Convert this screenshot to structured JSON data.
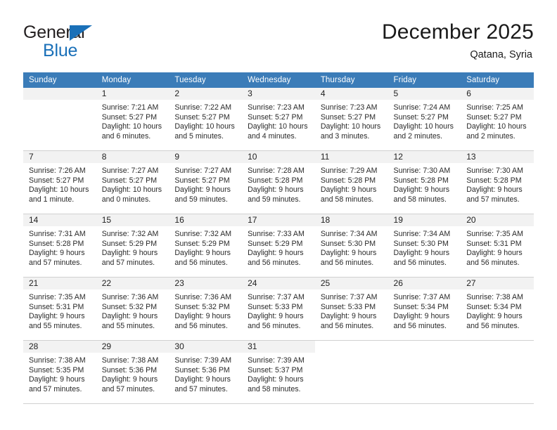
{
  "brand": {
    "name_part1": "General",
    "name_part2": "Blue",
    "triangle_icon": "triangle-icon",
    "color_primary": "#1a70b8",
    "color_text": "#231f20"
  },
  "header": {
    "title": "December 2025",
    "subtitle": "Qatana, Syria"
  },
  "calendar": {
    "header_background": "#3b7cb8",
    "daynum_background": "#f2f2f2",
    "weekday_headers": [
      "Sunday",
      "Monday",
      "Tuesday",
      "Wednesday",
      "Thursday",
      "Friday",
      "Saturday"
    ],
    "weeks": [
      [
        {
          "day": "",
          "lines": []
        },
        {
          "day": "1",
          "lines": [
            "Sunrise: 7:21 AM",
            "Sunset: 5:27 PM",
            "Daylight: 10 hours",
            "and 6 minutes."
          ]
        },
        {
          "day": "2",
          "lines": [
            "Sunrise: 7:22 AM",
            "Sunset: 5:27 PM",
            "Daylight: 10 hours",
            "and 5 minutes."
          ]
        },
        {
          "day": "3",
          "lines": [
            "Sunrise: 7:23 AM",
            "Sunset: 5:27 PM",
            "Daylight: 10 hours",
            "and 4 minutes."
          ]
        },
        {
          "day": "4",
          "lines": [
            "Sunrise: 7:23 AM",
            "Sunset: 5:27 PM",
            "Daylight: 10 hours",
            "and 3 minutes."
          ]
        },
        {
          "day": "5",
          "lines": [
            "Sunrise: 7:24 AM",
            "Sunset: 5:27 PM",
            "Daylight: 10 hours",
            "and 2 minutes."
          ]
        },
        {
          "day": "6",
          "lines": [
            "Sunrise: 7:25 AM",
            "Sunset: 5:27 PM",
            "Daylight: 10 hours",
            "and 2 minutes."
          ]
        }
      ],
      [
        {
          "day": "7",
          "lines": [
            "Sunrise: 7:26 AM",
            "Sunset: 5:27 PM",
            "Daylight: 10 hours",
            "and 1 minute."
          ]
        },
        {
          "day": "8",
          "lines": [
            "Sunrise: 7:27 AM",
            "Sunset: 5:27 PM",
            "Daylight: 10 hours",
            "and 0 minutes."
          ]
        },
        {
          "day": "9",
          "lines": [
            "Sunrise: 7:27 AM",
            "Sunset: 5:27 PM",
            "Daylight: 9 hours",
            "and 59 minutes."
          ]
        },
        {
          "day": "10",
          "lines": [
            "Sunrise: 7:28 AM",
            "Sunset: 5:28 PM",
            "Daylight: 9 hours",
            "and 59 minutes."
          ]
        },
        {
          "day": "11",
          "lines": [
            "Sunrise: 7:29 AM",
            "Sunset: 5:28 PM",
            "Daylight: 9 hours",
            "and 58 minutes."
          ]
        },
        {
          "day": "12",
          "lines": [
            "Sunrise: 7:30 AM",
            "Sunset: 5:28 PM",
            "Daylight: 9 hours",
            "and 58 minutes."
          ]
        },
        {
          "day": "13",
          "lines": [
            "Sunrise: 7:30 AM",
            "Sunset: 5:28 PM",
            "Daylight: 9 hours",
            "and 57 minutes."
          ]
        }
      ],
      [
        {
          "day": "14",
          "lines": [
            "Sunrise: 7:31 AM",
            "Sunset: 5:28 PM",
            "Daylight: 9 hours",
            "and 57 minutes."
          ]
        },
        {
          "day": "15",
          "lines": [
            "Sunrise: 7:32 AM",
            "Sunset: 5:29 PM",
            "Daylight: 9 hours",
            "and 57 minutes."
          ]
        },
        {
          "day": "16",
          "lines": [
            "Sunrise: 7:32 AM",
            "Sunset: 5:29 PM",
            "Daylight: 9 hours",
            "and 56 minutes."
          ]
        },
        {
          "day": "17",
          "lines": [
            "Sunrise: 7:33 AM",
            "Sunset: 5:29 PM",
            "Daylight: 9 hours",
            "and 56 minutes."
          ]
        },
        {
          "day": "18",
          "lines": [
            "Sunrise: 7:34 AM",
            "Sunset: 5:30 PM",
            "Daylight: 9 hours",
            "and 56 minutes."
          ]
        },
        {
          "day": "19",
          "lines": [
            "Sunrise: 7:34 AM",
            "Sunset: 5:30 PM",
            "Daylight: 9 hours",
            "and 56 minutes."
          ]
        },
        {
          "day": "20",
          "lines": [
            "Sunrise: 7:35 AM",
            "Sunset: 5:31 PM",
            "Daylight: 9 hours",
            "and 56 minutes."
          ]
        }
      ],
      [
        {
          "day": "21",
          "lines": [
            "Sunrise: 7:35 AM",
            "Sunset: 5:31 PM",
            "Daylight: 9 hours",
            "and 55 minutes."
          ]
        },
        {
          "day": "22",
          "lines": [
            "Sunrise: 7:36 AM",
            "Sunset: 5:32 PM",
            "Daylight: 9 hours",
            "and 55 minutes."
          ]
        },
        {
          "day": "23",
          "lines": [
            "Sunrise: 7:36 AM",
            "Sunset: 5:32 PM",
            "Daylight: 9 hours",
            "and 56 minutes."
          ]
        },
        {
          "day": "24",
          "lines": [
            "Sunrise: 7:37 AM",
            "Sunset: 5:33 PM",
            "Daylight: 9 hours",
            "and 56 minutes."
          ]
        },
        {
          "day": "25",
          "lines": [
            "Sunrise: 7:37 AM",
            "Sunset: 5:33 PM",
            "Daylight: 9 hours",
            "and 56 minutes."
          ]
        },
        {
          "day": "26",
          "lines": [
            "Sunrise: 7:37 AM",
            "Sunset: 5:34 PM",
            "Daylight: 9 hours",
            "and 56 minutes."
          ]
        },
        {
          "day": "27",
          "lines": [
            "Sunrise: 7:38 AM",
            "Sunset: 5:34 PM",
            "Daylight: 9 hours",
            "and 56 minutes."
          ]
        }
      ],
      [
        {
          "day": "28",
          "lines": [
            "Sunrise: 7:38 AM",
            "Sunset: 5:35 PM",
            "Daylight: 9 hours",
            "and 57 minutes."
          ]
        },
        {
          "day": "29",
          "lines": [
            "Sunrise: 7:38 AM",
            "Sunset: 5:36 PM",
            "Daylight: 9 hours",
            "and 57 minutes."
          ]
        },
        {
          "day": "30",
          "lines": [
            "Sunrise: 7:39 AM",
            "Sunset: 5:36 PM",
            "Daylight: 9 hours",
            "and 57 minutes."
          ]
        },
        {
          "day": "31",
          "lines": [
            "Sunrise: 7:39 AM",
            "Sunset: 5:37 PM",
            "Daylight: 9 hours",
            "and 58 minutes."
          ]
        },
        {
          "day": "",
          "lines": []
        },
        {
          "day": "",
          "lines": []
        },
        {
          "day": "",
          "lines": []
        }
      ]
    ]
  }
}
